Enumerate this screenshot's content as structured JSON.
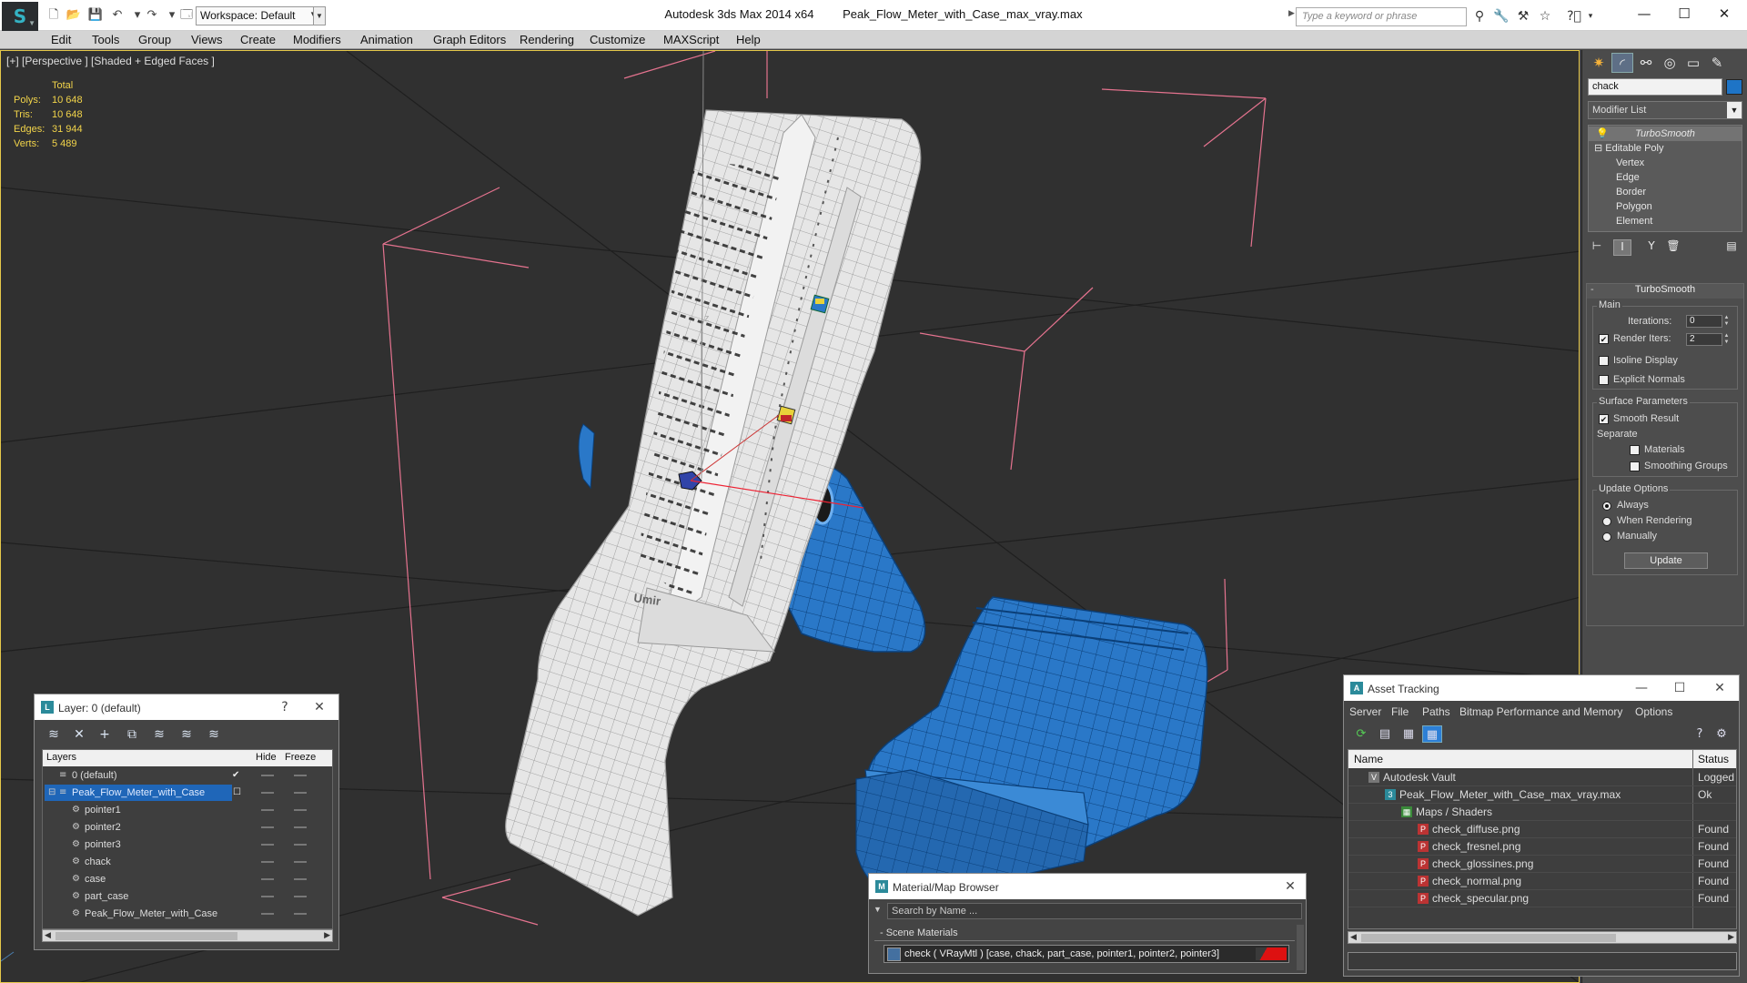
{
  "titlebar": {
    "workspace_label": "Workspace: Default",
    "app_name": "Autodesk 3ds Max  2014 x64",
    "file_name": "Peak_Flow_Meter_with_Case_max_vray.max",
    "search_placeholder": "Type a keyword or phrase"
  },
  "menu": [
    "Edit",
    "Tools",
    "Group",
    "Views",
    "Create",
    "Modifiers",
    "Animation",
    "Graph Editors",
    "Rendering",
    "Customize",
    "MAXScript",
    "Help"
  ],
  "viewport": {
    "label": "[+] [Perspective ] [Shaded + Edged Faces ]",
    "stats_header": "Total",
    "stats": [
      {
        "label": "Polys:",
        "value": "10 648"
      },
      {
        "label": "Tris:",
        "value": "10 648"
      },
      {
        "label": "Edges:",
        "value": "31 944"
      },
      {
        "label": "Verts:",
        "value": "5 489"
      }
    ],
    "model_text": "Umir",
    "gizmo_axis": "z"
  },
  "command_panel": {
    "object_name": "chack",
    "object_color": "#1e74c6",
    "modifier_list": "Modifier List",
    "stack": [
      "TurboSmooth",
      "Editable Poly",
      "Vertex",
      "Edge",
      "Border",
      "Polygon",
      "Element"
    ],
    "rollout_title": "TurboSmooth",
    "main_group": "Main",
    "iterations_label": "Iterations:",
    "iterations_value": "0",
    "render_iters_label": "Render Iters:",
    "render_iters_value": "2",
    "render_iters_checked": true,
    "isoline_label": "Isoline Display",
    "explicit_normals_label": "Explicit Normals",
    "surface_group": "Surface Parameters",
    "smooth_result_label": "Smooth Result",
    "separate_label": "Separate",
    "materials_label": "Materials",
    "smoothing_groups_label": "Smoothing Groups",
    "update_group": "Update Options",
    "update_options": [
      "Always",
      "When Rendering",
      "Manually"
    ],
    "update_selected": "Always",
    "update_button": "Update"
  },
  "layer_window": {
    "title": "Layer: 0 (default)",
    "help": "?",
    "columns": [
      "Layers",
      "Hide",
      "Freeze"
    ],
    "rows": [
      {
        "name": "0 (default)",
        "level": 0
      },
      {
        "name": "Peak_Flow_Meter_with_Case",
        "level": 0,
        "selected": true
      },
      {
        "name": "pointer1",
        "level": 1
      },
      {
        "name": "pointer2",
        "level": 1
      },
      {
        "name": "pointer3",
        "level": 1
      },
      {
        "name": "chack",
        "level": 1
      },
      {
        "name": "case",
        "level": 1
      },
      {
        "name": "part_case",
        "level": 1
      },
      {
        "name": "Peak_Flow_Meter_with_Case",
        "level": 1
      }
    ]
  },
  "material_browser": {
    "title": "Material/Map Browser",
    "search_placeholder": "Search by Name ...",
    "group": "- Scene Materials",
    "material": "check  ( VRayMtl ) [case, chack, part_case, pointer1, pointer2, pointer3]"
  },
  "asset_tracking": {
    "title": "Asset Tracking",
    "menu": [
      "Server",
      "File",
      "Paths",
      "Bitmap Performance and Memory",
      "Options"
    ],
    "columns": [
      "Name",
      "Status"
    ],
    "rows": [
      {
        "name": "Autodesk Vault",
        "status": "Logged",
        "level": 1,
        "icon": "vault"
      },
      {
        "name": "Peak_Flow_Meter_with_Case_max_vray.max",
        "status": "Ok",
        "level": 2,
        "icon": "max"
      },
      {
        "name": "Maps / Shaders",
        "status": "",
        "level": 3,
        "icon": "folder"
      },
      {
        "name": "check_diffuse.png",
        "status": "Found",
        "level": 4,
        "icon": "png"
      },
      {
        "name": "check_fresnel.png",
        "status": "Found",
        "level": 4,
        "icon": "png"
      },
      {
        "name": "check_glossines.png",
        "status": "Found",
        "level": 4,
        "icon": "png"
      },
      {
        "name": "check_normal.png",
        "status": "Found",
        "level": 4,
        "icon": "png"
      },
      {
        "name": "check_specular.png",
        "status": "Found",
        "level": 4,
        "icon": "png"
      }
    ]
  }
}
